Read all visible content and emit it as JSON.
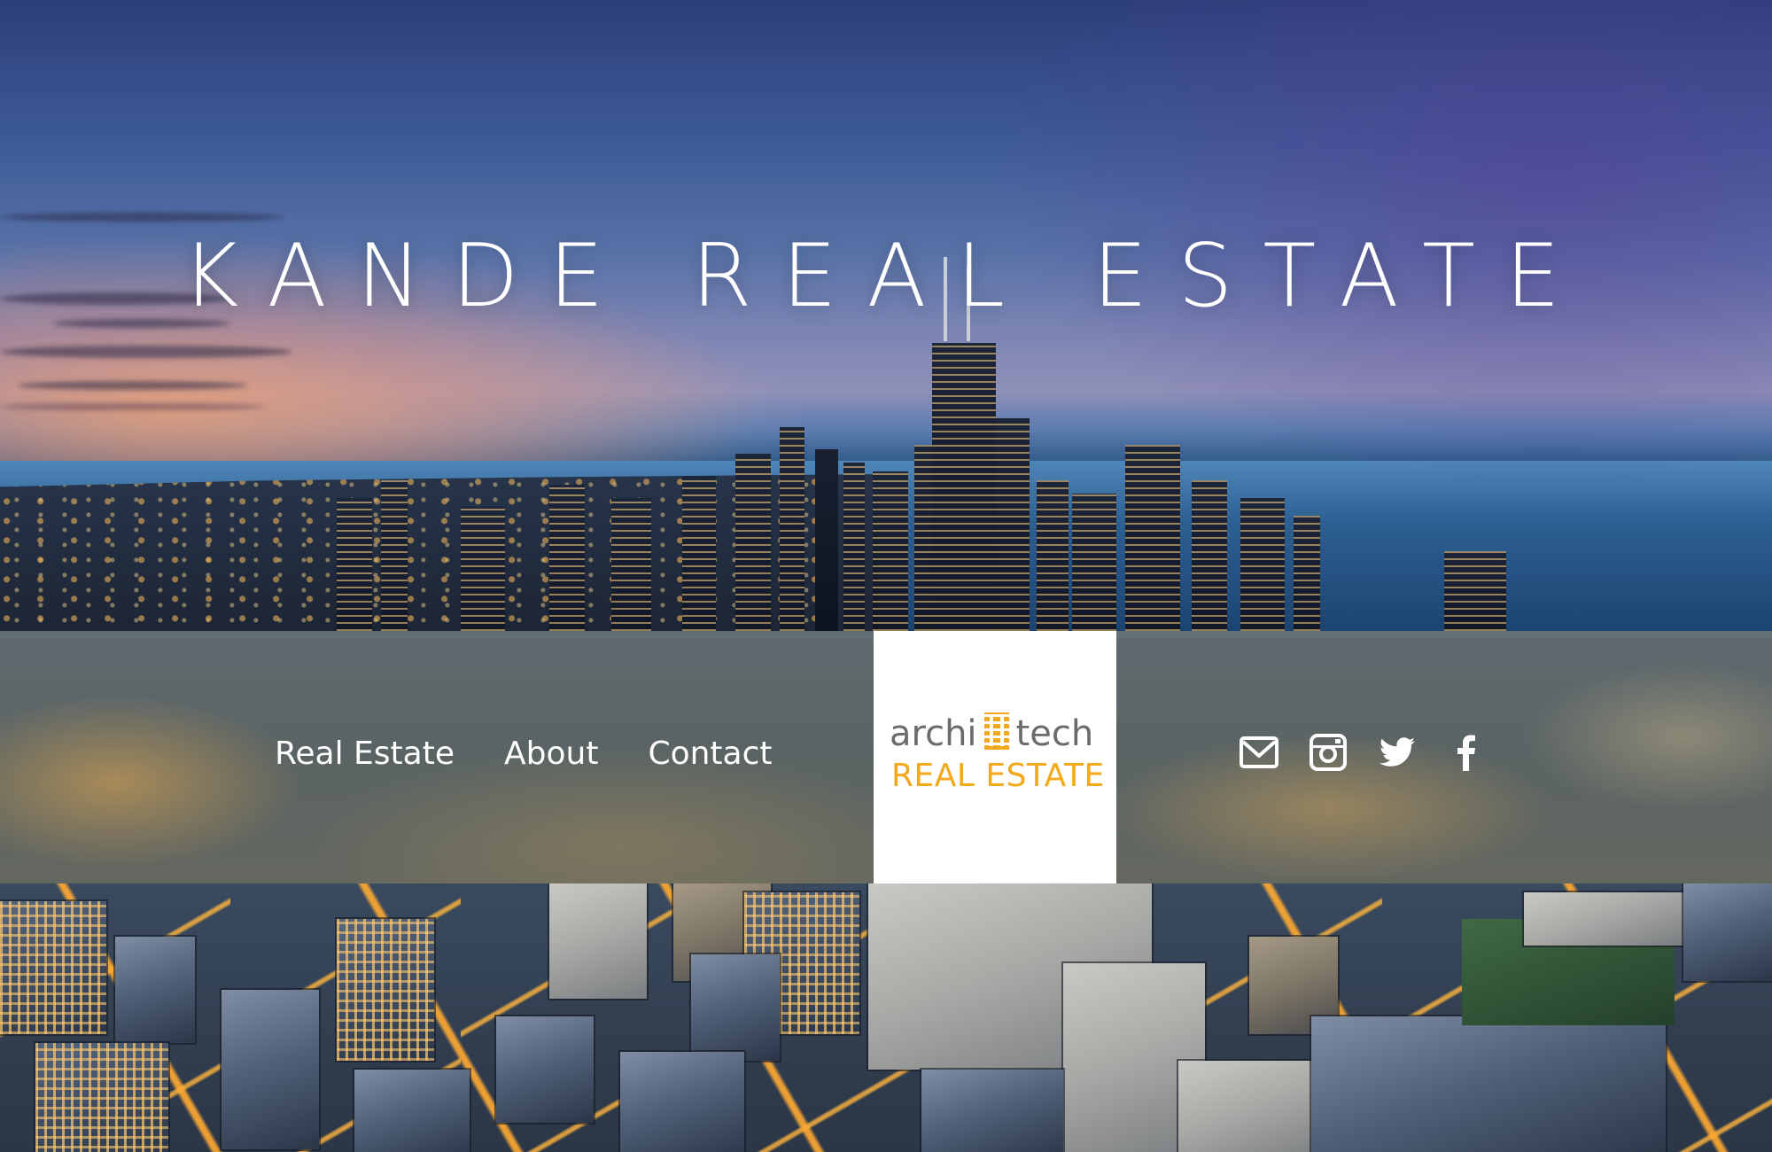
{
  "site": {
    "hero_title": "KANDE REAL ESTATE"
  },
  "nav": {
    "items": [
      {
        "label": "Real Estate"
      },
      {
        "label": "About"
      },
      {
        "label": "Contact"
      }
    ]
  },
  "logo": {
    "line1_left": "archi",
    "line1_right": "tech",
    "line2": "REAL ESTATE",
    "colors": {
      "text_gray": "#6b6b6b",
      "accent_orange": "#f2a91c"
    }
  },
  "social": {
    "icons": [
      "mail-icon",
      "instagram-icon",
      "twitter-icon",
      "facebook-icon"
    ]
  }
}
